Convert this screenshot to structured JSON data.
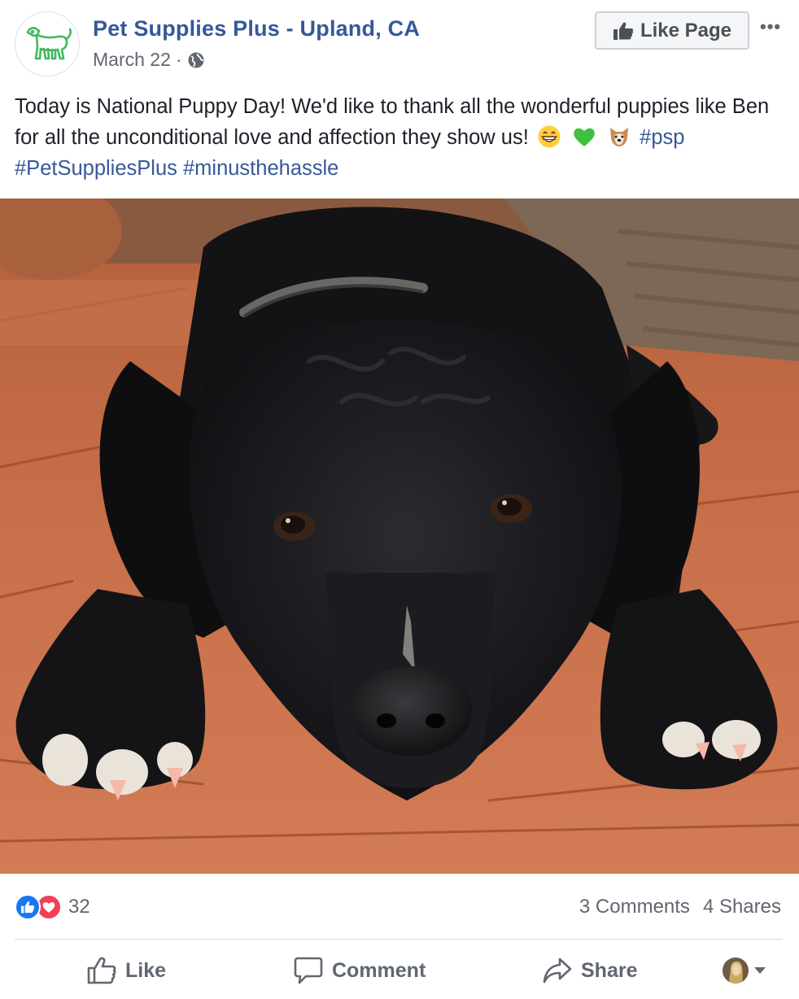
{
  "post": {
    "page_name": "Pet Supplies Plus - Upland, CA",
    "date": "March 22",
    "separator": "·",
    "like_page_label": "Like Page",
    "more_label": "•••",
    "text_main": "Today is National Puppy Day! We'd like to thank all the wonderful puppies like Ben for all the unconditional love and affection they show us!",
    "emojis": [
      "grinning-face-emoji",
      "green-heart-emoji",
      "dog-face-emoji"
    ],
    "hashtags": [
      "#psp",
      "#PetSuppliesPlus",
      "#minusthehassle"
    ]
  },
  "stats": {
    "reaction_count": "32",
    "comments": "3 Comments",
    "shares": "4 Shares"
  },
  "actions": {
    "like": "Like",
    "comment": "Comment",
    "share": "Share"
  },
  "colors": {
    "link": "#365899",
    "text": "#1d2129",
    "muted": "#606770",
    "like_blue": "#1877f2",
    "love_red": "#f33e58",
    "logo_green": "#3dbb5b"
  }
}
